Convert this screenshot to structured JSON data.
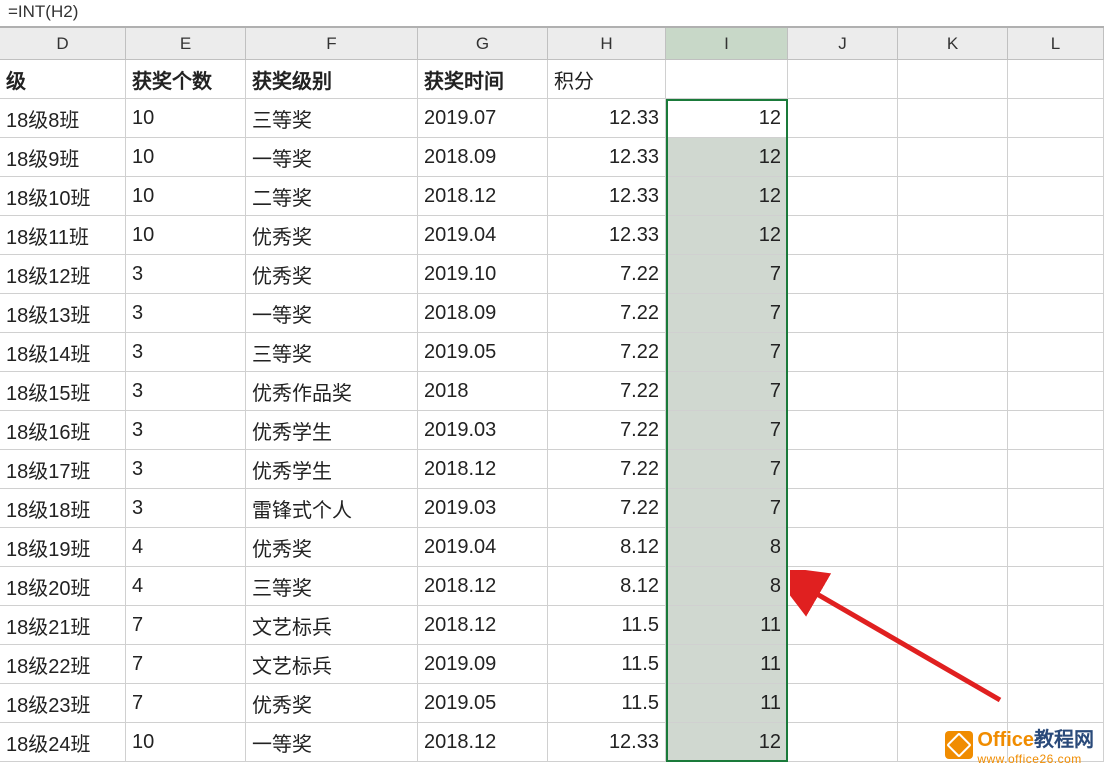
{
  "formula_bar": "=INT(H2)",
  "column_headers": [
    "D",
    "E",
    "F",
    "G",
    "H",
    "I",
    "J",
    "K",
    "L"
  ],
  "selected_column": "I",
  "header_row": {
    "D": "级",
    "E": "获奖个数",
    "F": "获奖级别",
    "G": "获奖时间",
    "H": "积分",
    "I": ""
  },
  "rows": [
    {
      "D": "18级8班",
      "E": "10",
      "F": "三等奖",
      "G": "2019.07",
      "H": "12.33",
      "I": "12"
    },
    {
      "D": "18级9班",
      "E": "10",
      "F": "一等奖",
      "G": "2018.09",
      "H": "12.33",
      "I": "12"
    },
    {
      "D": "18级10班",
      "E": "10",
      "F": "二等奖",
      "G": "2018.12",
      "H": "12.33",
      "I": "12"
    },
    {
      "D": "18级11班",
      "E": "10",
      "F": "优秀奖",
      "G": "2019.04",
      "H": "12.33",
      "I": "12"
    },
    {
      "D": "18级12班",
      "E": "3",
      "F": "优秀奖",
      "G": "2019.10",
      "H": "7.22",
      "I": "7"
    },
    {
      "D": "18级13班",
      "E": "3",
      "F": "一等奖",
      "G": "2018.09",
      "H": "7.22",
      "I": "7"
    },
    {
      "D": "18级14班",
      "E": "3",
      "F": "三等奖",
      "G": "2019.05",
      "H": "7.22",
      "I": "7"
    },
    {
      "D": "18级15班",
      "E": "3",
      "F": "优秀作品奖",
      "G": "2018",
      "H": "7.22",
      "I": "7"
    },
    {
      "D": "18级16班",
      "E": "3",
      "F": "优秀学生",
      "G": "2019.03",
      "H": "7.22",
      "I": "7"
    },
    {
      "D": "18级17班",
      "E": "3",
      "F": "优秀学生",
      "G": "2018.12",
      "H": "7.22",
      "I": "7"
    },
    {
      "D": "18级18班",
      "E": "3",
      "F": "雷锋式个人",
      "G": "2019.03",
      "H": "7.22",
      "I": "7"
    },
    {
      "D": "18级19班",
      "E": "4",
      "F": "优秀奖",
      "G": "2019.04",
      "H": "8.12",
      "I": "8"
    },
    {
      "D": "18级20班",
      "E": "4",
      "F": "三等奖",
      "G": "2018.12",
      "H": "8.12",
      "I": "8"
    },
    {
      "D": "18级21班",
      "E": "7",
      "F": "文艺标兵",
      "G": "2018.12",
      "H": "11.5",
      "I": "11"
    },
    {
      "D": "18级22班",
      "E": "7",
      "F": "文艺标兵",
      "G": "2019.09",
      "H": "11.5",
      "I": "11"
    },
    {
      "D": "18级23班",
      "E": "7",
      "F": "优秀奖",
      "G": "2019.05",
      "H": "11.5",
      "I": "11"
    },
    {
      "D": "18级24班",
      "E": "10",
      "F": "一等奖",
      "G": "2018.12",
      "H": "12.33",
      "I": "12"
    }
  ],
  "watermark": {
    "text_orange": "Office",
    "text_navy": "教程网",
    "url": "www.office26.com"
  }
}
